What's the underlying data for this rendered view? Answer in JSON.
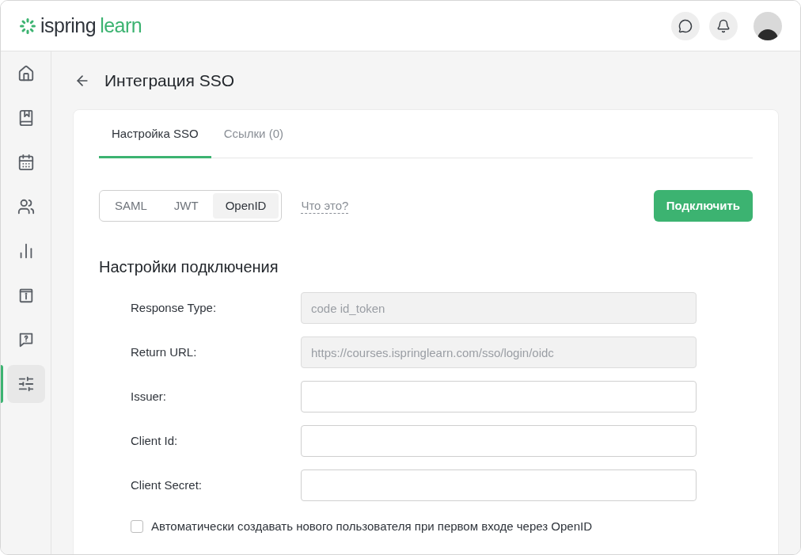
{
  "header": {
    "logo": {
      "brand": "ispring",
      "product": "learn"
    }
  },
  "sidebar": {
    "items": [
      {
        "kind": "home",
        "selected": false
      },
      {
        "kind": "book",
        "selected": false
      },
      {
        "kind": "calendar",
        "selected": false
      },
      {
        "kind": "users",
        "selected": false
      },
      {
        "kind": "chart",
        "selected": false
      },
      {
        "kind": "info",
        "selected": false
      },
      {
        "kind": "help",
        "selected": false
      },
      {
        "kind": "settings",
        "selected": true
      }
    ]
  },
  "page": {
    "title": "Интеграция SSO"
  },
  "tabs": [
    {
      "label": "Настройка SSO",
      "selected": true
    },
    {
      "label": "Ссылки (0)",
      "selected": false
    }
  ],
  "protocols": [
    {
      "label": "SAML",
      "selected": false
    },
    {
      "label": "JWT",
      "selected": false
    },
    {
      "label": "OpenID",
      "selected": true
    }
  ],
  "help_link": "Что это?",
  "connect_button": "Подключить",
  "section_title": "Настройки подключения",
  "fields": [
    {
      "label": "Response Type:",
      "value": "code id_token",
      "disabled": true
    },
    {
      "label": "Return URL:",
      "value": "https://courses.ispringlearn.com/sso/login/oidc",
      "disabled": true
    },
    {
      "label": "Issuer:",
      "disabled": false
    },
    {
      "label": "Client Id:",
      "disabled": false
    },
    {
      "label": "Client Secret:",
      "disabled": false
    }
  ],
  "auto_create": {
    "label": "Автоматически создавать нового пользователя при первом входе через OpenID",
    "checked": false
  }
}
